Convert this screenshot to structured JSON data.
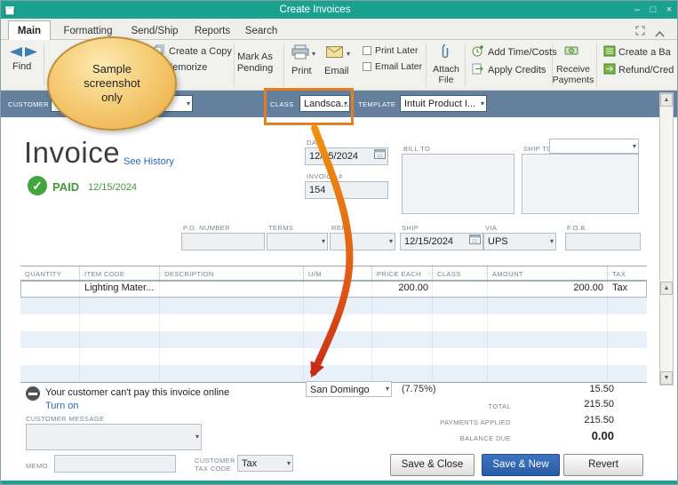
{
  "window": {
    "title": "Create Invoices",
    "minimize": "–",
    "maximize": "□",
    "close": "×"
  },
  "tabs": {
    "main": "Main",
    "formatting": "Formatting",
    "send_ship": "Send/Ship",
    "reports": "Reports",
    "search": "Search"
  },
  "toolbar": {
    "find": "Find",
    "create_a_copy": "Create a Copy",
    "memorize": "Memorize",
    "mark_as_pending_1": "Mark As",
    "mark_as_pending_2": "Pending",
    "print": "Print",
    "email": "Email",
    "print_later": "Print Later",
    "email_later": "Email Later",
    "print_later_checked": false,
    "email_later_checked": false,
    "attach_1": "Attach",
    "attach_2": "File",
    "add_time_costs": "Add Time/Costs",
    "apply_credits": "Apply Credits",
    "receive_1": "Receive",
    "receive_2": "Payments",
    "create_a_batch": "Create a Ba",
    "refund_credit": "Refund/Cred"
  },
  "callout": {
    "line1": "Sample",
    "line2": "screenshot",
    "line3": "only"
  },
  "customer_bar": {
    "customer_label": "CUSTOMER",
    "class_label": "CLASS",
    "class_value": "Landsca...",
    "template_label": "TEMPLATE",
    "template_value": "Intuit Product I..."
  },
  "invoice": {
    "heading": "Invoice",
    "see_history": "See History",
    "paid_label": "PAID",
    "paid_date": "12/15/2024",
    "date_label": "DATE",
    "date_value": "12/15/2024",
    "invoice_no_label": "INVOICE #",
    "invoice_no_value": "154",
    "bill_to_label": "BILL TO",
    "ship_to_label": "SHIP TO",
    "po_number_label": "P.O. NUMBER",
    "terms_label": "TERMS",
    "rep_label": "REP",
    "ship_label": "SHIP",
    "ship_date": "12/15/2024",
    "via_label": "VIA",
    "via_value": "UPS",
    "fob_label": "F.O.B."
  },
  "table": {
    "headers": [
      "QUANTITY",
      "ITEM CODE",
      "DESCRIPTION",
      "U/M",
      "PRICE EACH",
      "CLASS",
      "AMOUNT",
      "TAX"
    ],
    "rows": [
      {
        "item_code": "Lighting Mater...",
        "price_each": "200.00",
        "amount": "200.00",
        "tax": "Tax"
      }
    ]
  },
  "footer": {
    "online_notice": "Your customer can't pay this invoice online",
    "turn_on": "Turn on",
    "tax_name": "San Domingo",
    "tax_rate": "(7.75%)",
    "tax_amount": "15.50",
    "total_label": "TOTAL",
    "total_value": "215.50",
    "payments_label": "PAYMENTS APPLIED",
    "payments_value": "215.50",
    "balance_label": "BALANCE DUE",
    "balance_value": "0.00",
    "customer_message_label": "CUSTOMER MESSAGE",
    "memo_label": "MEMO",
    "tax_code_label_1": "CUSTOMER",
    "tax_code_label_2": "TAX CODE",
    "tax_code_value": "Tax",
    "save_close": "Save & Close",
    "save_new": "Save & New",
    "revert": "Revert"
  }
}
